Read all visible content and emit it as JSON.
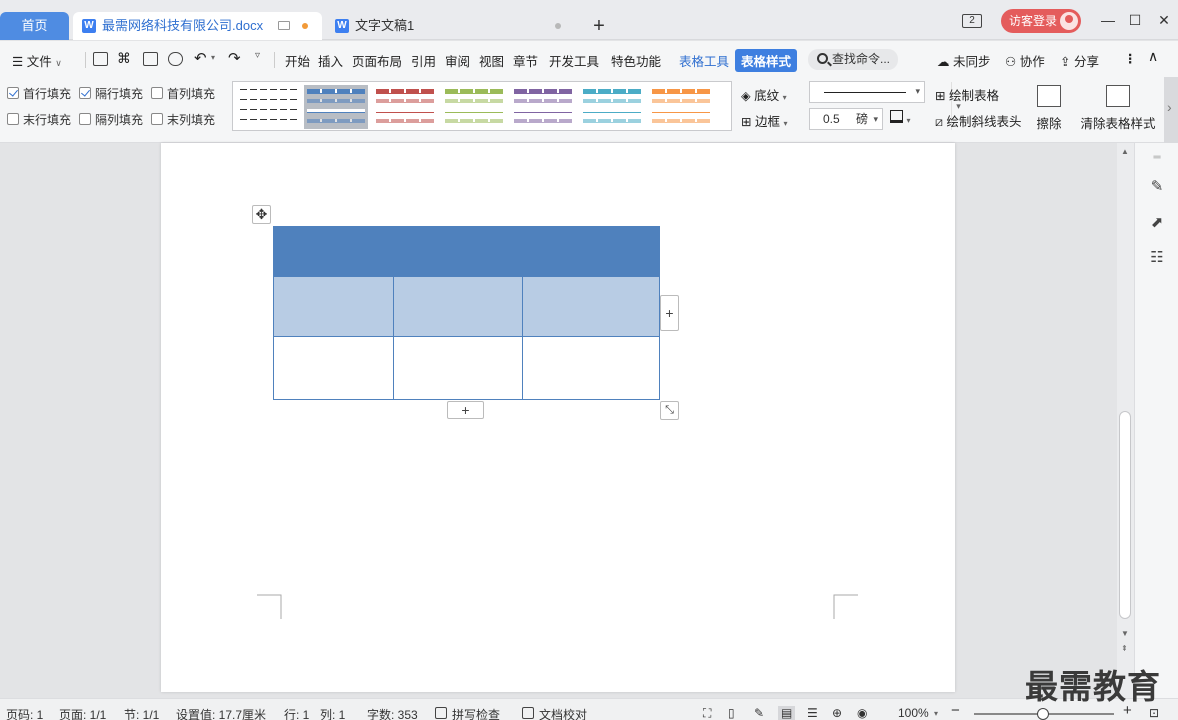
{
  "tabs": {
    "home_label": "首页",
    "active_doc": "最需网络科技有限公司.docx",
    "inactive_doc": "文字文稿1"
  },
  "titlebar": {
    "window_count": "2",
    "visitor_login": "访客登录"
  },
  "menu": {
    "file": "文件",
    "items": [
      "开始",
      "插入",
      "页面布局",
      "引用",
      "审阅",
      "视图",
      "章节",
      "开发工具",
      "特色功能"
    ],
    "table_tools": "表格工具",
    "table_style": "表格样式",
    "search_placeholder": "查找命令...",
    "unsynced": "未同步",
    "collaborate": "协作",
    "share": "分享"
  },
  "ribbon": {
    "checkboxes": [
      {
        "label": "首行填充",
        "checked": true
      },
      {
        "label": "隔行填充",
        "checked": true
      },
      {
        "label": "首列填充",
        "checked": false
      },
      {
        "label": "末行填充",
        "checked": false
      },
      {
        "label": "隔列填充",
        "checked": false
      },
      {
        "label": "末列填充",
        "checked": false
      }
    ],
    "style_colors": [
      "#333333",
      "#4f81bd",
      "#c0504d",
      "#9bbb59",
      "#8064a2",
      "#4bacc6",
      "#f79646"
    ],
    "selected_style_index": 1,
    "shading": "底纹",
    "border": "边框",
    "line_weight": "0.5",
    "line_weight_unit": "磅",
    "draw_table": "绘制表格",
    "draw_diagonal": "绘制斜线表头",
    "erase": "擦除",
    "clear_style": "清除表格样式"
  },
  "table": {
    "header_color": "#4f81bd",
    "band_color": "#b8cce4",
    "border_color": "#4f81bd"
  },
  "status": {
    "page_code": "页码: 1",
    "pages": "页面: 1/1",
    "section": "节: 1/1",
    "position": "设置值: 17.7厘米",
    "row": "行: 1",
    "col": "列: 1",
    "word_count": "字数: 353",
    "spell_check": "拼写检查",
    "doc_proof": "文档校对",
    "zoom": "100%"
  },
  "watermark": "最需教育"
}
